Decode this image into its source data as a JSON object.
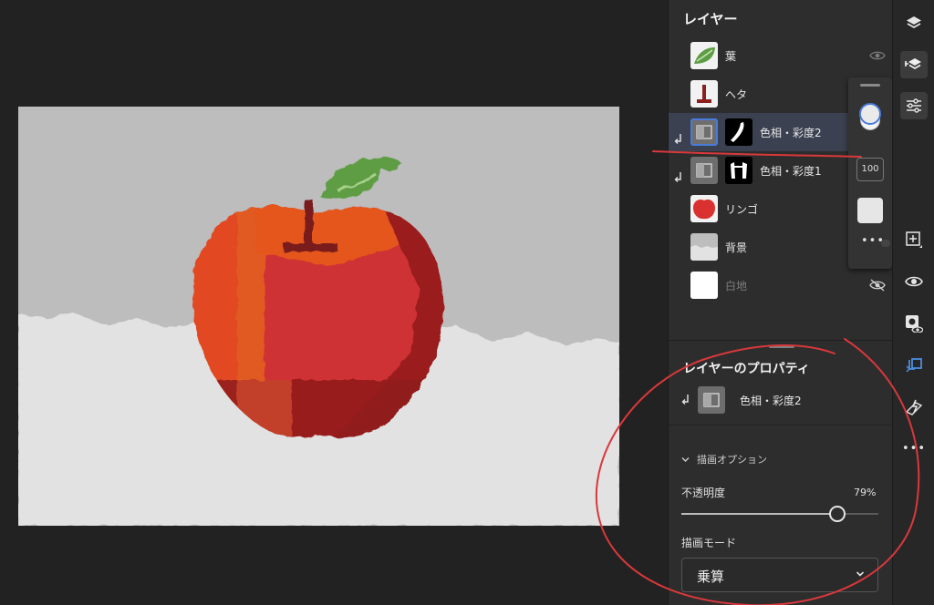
{
  "layers_panel": {
    "title": "レイヤー",
    "layers": [
      {
        "name": "葉"
      },
      {
        "name": "ヘタ"
      },
      {
        "name": "色相・彩度2"
      },
      {
        "name": "色相・彩度1"
      },
      {
        "name": "リンゴ"
      },
      {
        "name": "背景"
      },
      {
        "name": "白地"
      }
    ],
    "selected_layer": "色相・彩度2"
  },
  "quick_popover": {
    "opacity": "100",
    "more": "•••"
  },
  "properties": {
    "title": "レイヤーのプロパティ",
    "layer_name": "色相・彩度2",
    "section": "描画オプション",
    "opacity_label": "不透明度",
    "opacity_value": "79%",
    "opacity_fraction": 0.79,
    "blend_label": "描画モード",
    "blend_mode": "乗算"
  },
  "toolbar": {
    "icons": [
      "layers-icon",
      "layer-stack-icon",
      "adjustments-icon",
      "add-layer-icon",
      "visibility-icon",
      "mask-visibility-icon",
      "clip-layer-icon",
      "lightning-icon",
      "more-icon"
    ],
    "more": "•••"
  },
  "colors": {
    "apple_red": "#d8312f",
    "apple_orange": "#e45a1c",
    "leaf_green": "#5e9d45",
    "stem_brown": "#7a1f1a",
    "sky_gray": "#bdbdbd",
    "ground_gray": "#e2e2e2",
    "selection_blue": "#4a7bd6",
    "annotation_red": "#d9383c"
  }
}
